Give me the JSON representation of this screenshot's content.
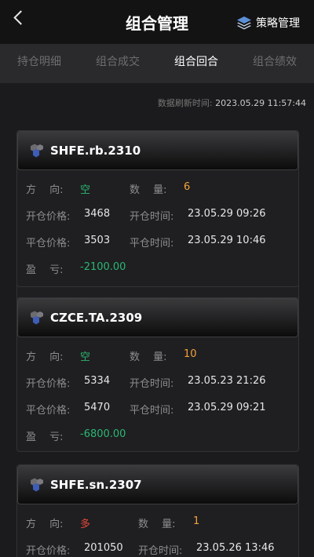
{
  "header": {
    "title": "组合管理",
    "strategy_label": "策略管理"
  },
  "tabs": [
    {
      "label": "持仓明细"
    },
    {
      "label": "组合成交"
    },
    {
      "label": "组合回合"
    },
    {
      "label": "组合绩效"
    }
  ],
  "refresh": {
    "label": "数据刷新时间:",
    "time": "2023.05.29 11:57:44"
  },
  "field_labels": {
    "direction": "方　 向:",
    "quantity": "数　 量:",
    "open_price": "开仓价格:",
    "open_time": "开仓时间:",
    "close_price": "平仓价格:",
    "close_time": "平仓时间:",
    "pnl": "盈　 亏:"
  },
  "cards": [
    {
      "code": "SHFE.rb.2310",
      "direction": "空",
      "quantity": "6",
      "open_price": "3468",
      "open_time": "23.05.29 09:26",
      "close_price": "3503",
      "close_time": "23.05.29 10:46",
      "pnl": "-2100.00"
    },
    {
      "code": "CZCE.TA.2309",
      "direction": "空",
      "quantity": "10",
      "open_price": "5334",
      "open_time": "23.05.23 21:26",
      "close_price": "5470",
      "close_time": "23.05.29 09:21",
      "pnl": "-6800.00"
    },
    {
      "code": "SHFE.sn.2307",
      "direction": "多",
      "quantity": "1",
      "open_price": "201050",
      "open_time": "23.05.26 13:46"
    }
  ],
  "colors": {
    "short": "#2bb673",
    "long": "#e6473b",
    "quantity": "#f5a23a",
    "loss": "#2bb673"
  }
}
